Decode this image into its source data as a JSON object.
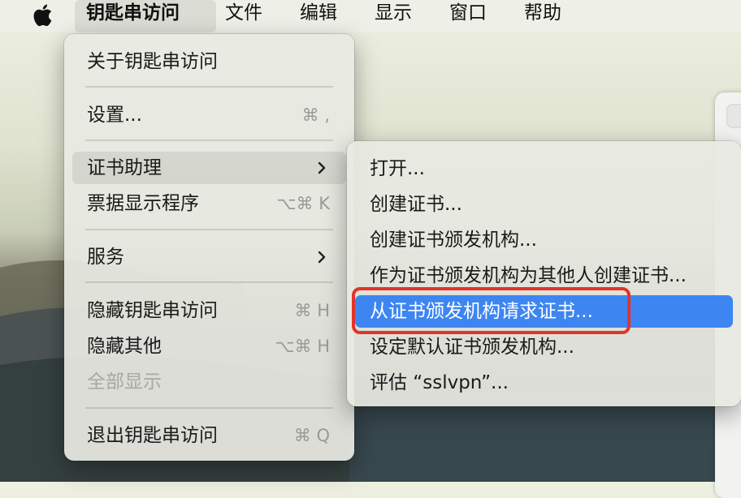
{
  "menubar": {
    "apple_icon": "apple-logo-icon",
    "items": [
      "钥匙串访问",
      "文件",
      "编辑",
      "显示",
      "窗口",
      "帮助"
    ]
  },
  "main_menu": {
    "about": "关于钥匙串访问",
    "settings": "设置...",
    "settings_shortcut": "⌘ ,",
    "cert_assistant": "证书助理",
    "ticket_viewer": "票据显示程序",
    "ticket_viewer_shortcut": "⌥⌘ K",
    "services": "服务",
    "hide_app": "隐藏钥匙串访问",
    "hide_app_shortcut": "⌘ H",
    "hide_others": "隐藏其他",
    "hide_others_shortcut": "⌥⌘ H",
    "show_all": "全部显示",
    "quit": "退出钥匙串访问",
    "quit_shortcut": "⌘ Q"
  },
  "submenu": {
    "items": [
      "打开...",
      "创建证书...",
      "创建证书颁发机构...",
      "作为证书颁发机构为其他人创建证书...",
      "从证书颁发机构请求证书...",
      "设定默认证书颁发机构...",
      "评估 “sslvpn”..."
    ],
    "selected_index": 4
  },
  "colors": {
    "selection": "#3d86f2",
    "annotation": "#e2342a"
  }
}
